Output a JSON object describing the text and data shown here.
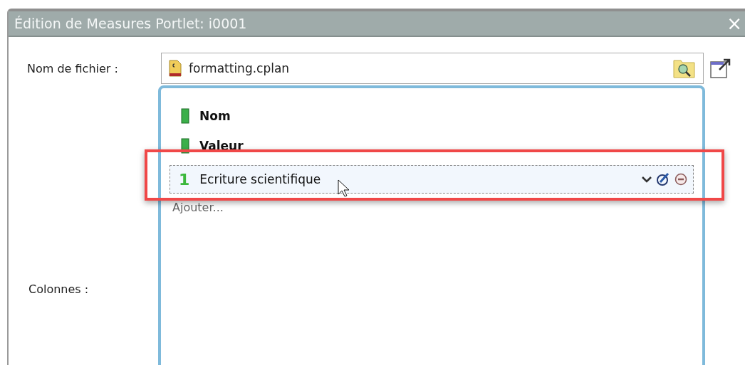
{
  "window": {
    "title": "Édition de Measures Portlet: i0001",
    "close": "×"
  },
  "file": {
    "label": "Nom de fichier :",
    "value": "formatting.cplan"
  },
  "columns": {
    "label": "Colonnes :",
    "items": [
      {
        "kind": "column",
        "label": "Nom",
        "selected": false
      },
      {
        "kind": "column",
        "label": "Valeur",
        "selected": false
      },
      {
        "kind": "format",
        "number": "1",
        "label": "Ecriture scientifique",
        "selected": true
      }
    ],
    "add": "Ajouter..."
  }
}
